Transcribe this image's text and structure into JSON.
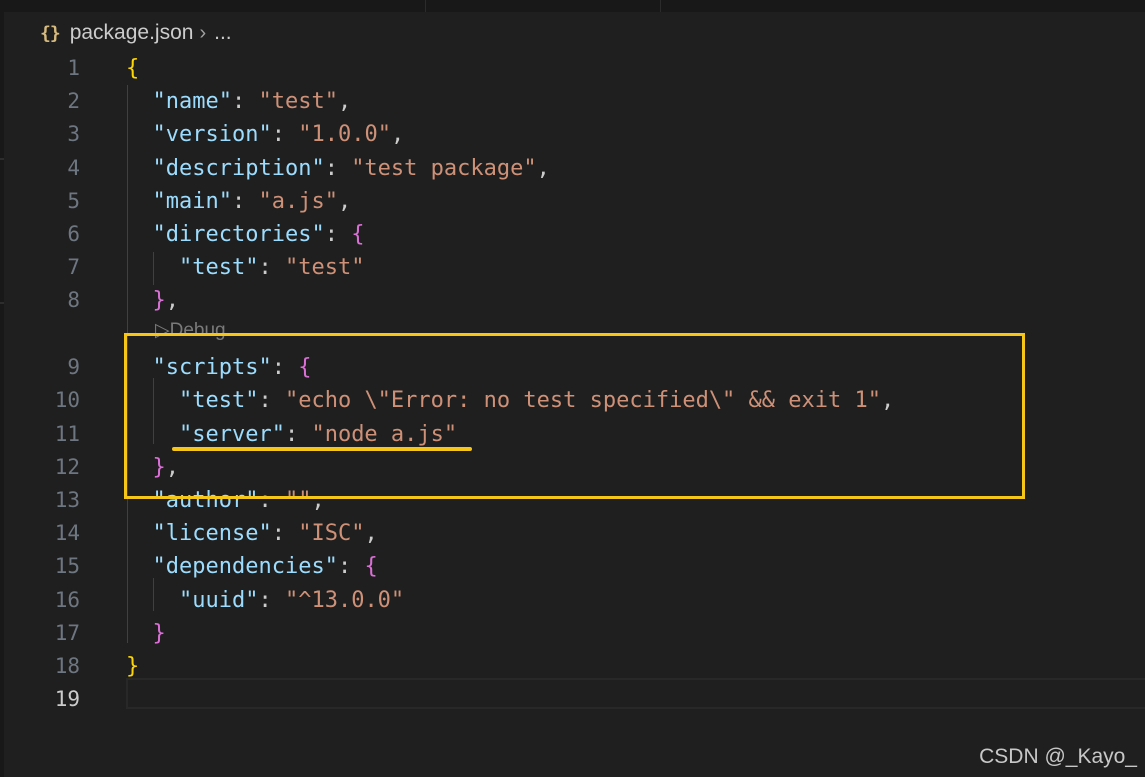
{
  "breadcrumb": {
    "icon": "json-braces-icon",
    "icon_glyph": "{}",
    "file": "package.json",
    "separator": "›",
    "more": "..."
  },
  "codelens": {
    "label": "Debug"
  },
  "watermark": "CSDN @_Kayo_",
  "colors": {
    "background": "#1f1f1f",
    "key": "#9cdcfe",
    "string": "#ce9178",
    "bracket_outer": "#ffd700",
    "bracket_inner": "#da70d6",
    "annotation": "#f5c518"
  },
  "lines": [
    {
      "n": "1",
      "t": [
        [
          "b1",
          "{"
        ]
      ]
    },
    {
      "n": "2",
      "t": [
        [
          "p",
          "  "
        ],
        [
          "k",
          "\"name\""
        ],
        [
          "p",
          ": "
        ],
        [
          "s",
          "\"test\""
        ],
        [
          "p",
          ","
        ]
      ]
    },
    {
      "n": "3",
      "t": [
        [
          "p",
          "  "
        ],
        [
          "k",
          "\"version\""
        ],
        [
          "p",
          ": "
        ],
        [
          "s",
          "\"1.0.0\""
        ],
        [
          "p",
          ","
        ]
      ]
    },
    {
      "n": "4",
      "t": [
        [
          "p",
          "  "
        ],
        [
          "k",
          "\"description\""
        ],
        [
          "p",
          ": "
        ],
        [
          "s",
          "\"test package\""
        ],
        [
          "p",
          ","
        ]
      ]
    },
    {
      "n": "5",
      "t": [
        [
          "p",
          "  "
        ],
        [
          "k",
          "\"main\""
        ],
        [
          "p",
          ": "
        ],
        [
          "s",
          "\"a.js\""
        ],
        [
          "p",
          ","
        ]
      ]
    },
    {
      "n": "6",
      "t": [
        [
          "p",
          "  "
        ],
        [
          "k",
          "\"directories\""
        ],
        [
          "p",
          ": "
        ],
        [
          "b2",
          "{"
        ]
      ]
    },
    {
      "n": "7",
      "t": [
        [
          "p",
          "    "
        ],
        [
          "k",
          "\"test\""
        ],
        [
          "p",
          ": "
        ],
        [
          "s",
          "\"test\""
        ]
      ]
    },
    {
      "n": "8",
      "t": [
        [
          "p",
          "  "
        ],
        [
          "b2",
          "}"
        ],
        [
          "p",
          ","
        ]
      ]
    },
    {
      "n": "9",
      "t": [
        [
          "p",
          "  "
        ],
        [
          "k",
          "\"scripts\""
        ],
        [
          "p",
          ": "
        ],
        [
          "b2",
          "{"
        ]
      ]
    },
    {
      "n": "10",
      "t": [
        [
          "p",
          "    "
        ],
        [
          "k",
          "\"test\""
        ],
        [
          "p",
          ": "
        ],
        [
          "s",
          "\"echo \\\"Error: no test specified\\\" && exit 1\""
        ],
        [
          "p",
          ","
        ]
      ]
    },
    {
      "n": "11",
      "t": [
        [
          "p",
          "    "
        ],
        [
          "k",
          "\"server\""
        ],
        [
          "p",
          ": "
        ],
        [
          "s",
          "\"node a.js\""
        ]
      ]
    },
    {
      "n": "12",
      "t": [
        [
          "p",
          "  "
        ],
        [
          "b2",
          "}"
        ],
        [
          "p",
          ","
        ]
      ]
    },
    {
      "n": "13",
      "t": [
        [
          "p",
          "  "
        ],
        [
          "k",
          "\"author\""
        ],
        [
          "p",
          ": "
        ],
        [
          "s",
          "\"\""
        ],
        [
          "p",
          ","
        ]
      ]
    },
    {
      "n": "14",
      "t": [
        [
          "p",
          "  "
        ],
        [
          "k",
          "\"license\""
        ],
        [
          "p",
          ": "
        ],
        [
          "s",
          "\"ISC\""
        ],
        [
          "p",
          ","
        ]
      ]
    },
    {
      "n": "15",
      "t": [
        [
          "p",
          "  "
        ],
        [
          "k",
          "\"dependencies\""
        ],
        [
          "p",
          ": "
        ],
        [
          "b2",
          "{"
        ]
      ]
    },
    {
      "n": "16",
      "t": [
        [
          "p",
          "    "
        ],
        [
          "k",
          "\"uuid\""
        ],
        [
          "p",
          ": "
        ],
        [
          "s",
          "\"^13.0.0\""
        ]
      ]
    },
    {
      "n": "17",
      "t": [
        [
          "p",
          "  "
        ],
        [
          "b2",
          "}"
        ]
      ]
    },
    {
      "n": "18",
      "t": [
        [
          "b1",
          "}"
        ]
      ]
    },
    {
      "n": "19",
      "t": []
    }
  ],
  "active_line": "19",
  "annotations": [
    {
      "type": "box",
      "label": "highlight-box",
      "lines": [
        "9",
        "13"
      ]
    },
    {
      "type": "underline",
      "label": "underline",
      "line": "11"
    }
  ]
}
